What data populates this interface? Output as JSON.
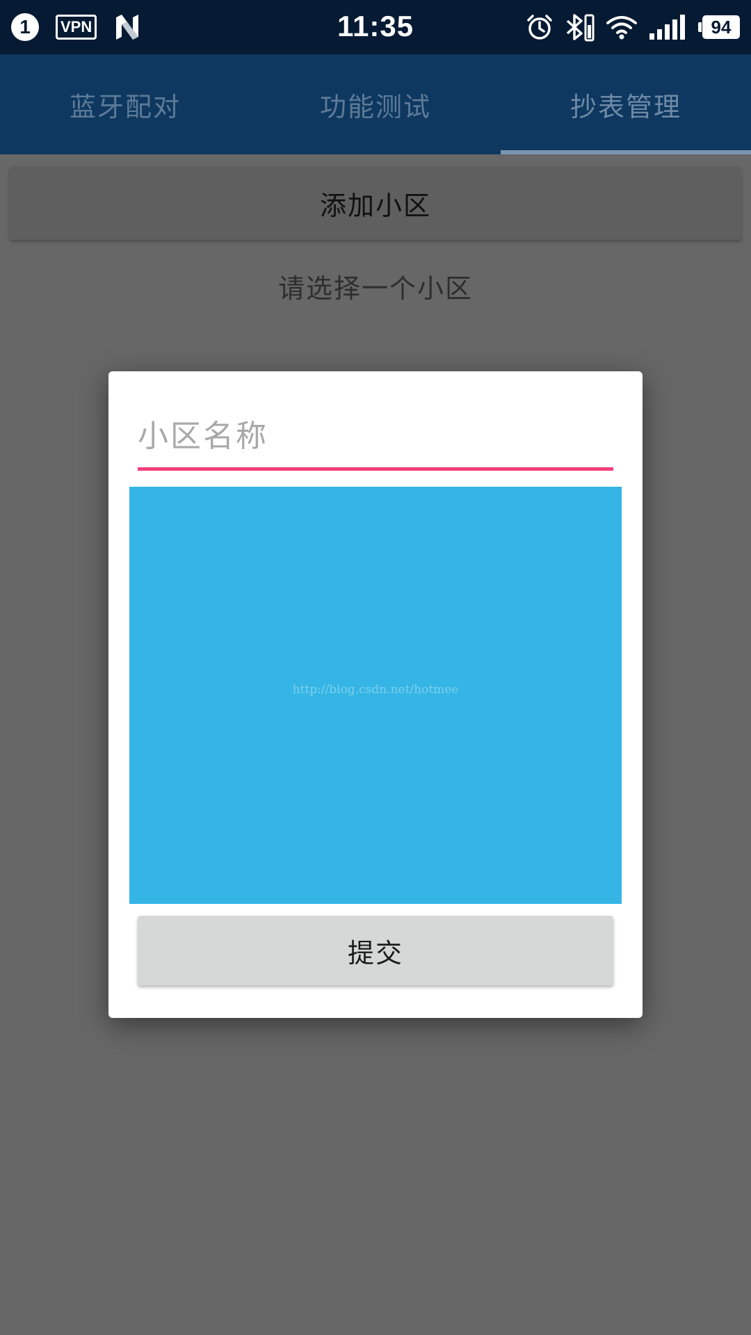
{
  "status_bar": {
    "notification_count": "1",
    "vpn_label": "VPN",
    "clock": "11:35",
    "battery_level": "94",
    "icons": [
      "notification-badge-icon",
      "vpn-icon",
      "n-logo-icon",
      "alarm-icon",
      "bluetooth-icon",
      "wifi-icon",
      "signal-icon",
      "battery-icon"
    ]
  },
  "tabs": [
    {
      "label": "蓝牙配对",
      "active": false
    },
    {
      "label": "功能测试",
      "active": false
    },
    {
      "label": "抄表管理",
      "active": true
    }
  ],
  "main": {
    "add_button_label": "添加小区",
    "hint_text": "请选择一个小区"
  },
  "dialog": {
    "name_placeholder": "小区名称",
    "name_value": "",
    "image_watermark": "http://blog.csdn.net/hotmee",
    "submit_label": "提交"
  },
  "colors": {
    "status_bar": "#061a33",
    "tab_bar": "#0e3860",
    "scrim_background": "#676767",
    "input_accent": "#f2407a",
    "image_box": "#35b5e5",
    "submit_button": "#d6d7d7"
  }
}
